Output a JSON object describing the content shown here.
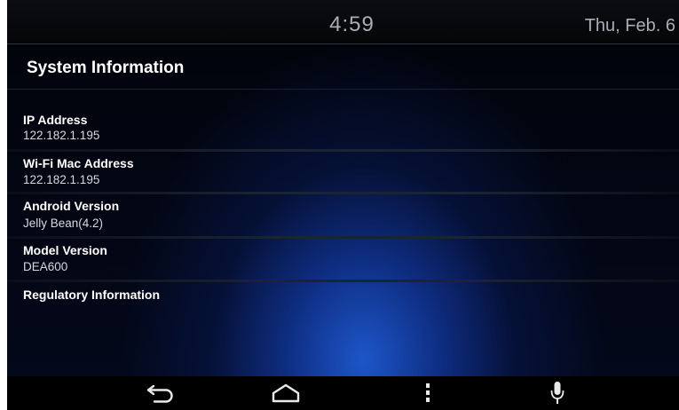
{
  "status_bar": {
    "time": "4:59",
    "date": "Thu, Feb. 6"
  },
  "page": {
    "title": "System Information"
  },
  "items": [
    {
      "label": "IP Address",
      "value": "122.182.1.195"
    },
    {
      "label": "Wi-Fi Mac Address",
      "value": "122.182.1.195"
    },
    {
      "label": "Android Version",
      "value": "Jelly Bean(4.2)"
    },
    {
      "label": "Model Version",
      "value": "DEA600"
    },
    {
      "label": "Regulatory Information"
    }
  ],
  "nav_bar": {
    "icons": [
      "back-icon",
      "home-icon",
      "menu-icon",
      "microphone-icon"
    ],
    "icon_color": "#e8e8e8"
  },
  "colors": {
    "background": "#000000",
    "accent_glow": "#1e5ad2",
    "label_text": "#ffffff",
    "value_text": "#d6d9de",
    "status_text": "#a9aeb6"
  }
}
